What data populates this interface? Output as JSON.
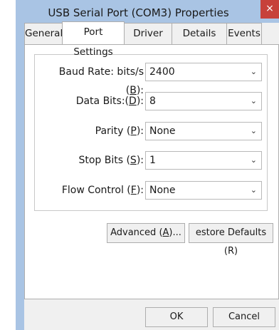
{
  "window": {
    "title": "USB Serial Port (COM3) Properties",
    "close_glyph": "×"
  },
  "tabs": [
    {
      "label": "General"
    },
    {
      "label": "Port Settings",
      "active": true
    },
    {
      "label": "Driver"
    },
    {
      "label": "Details"
    },
    {
      "label": "Events"
    }
  ],
  "settings": {
    "baud": {
      "label_pre": "Baud Rate: bits/s (",
      "key": "B",
      "label_post": "):",
      "value": "2400"
    },
    "databits": {
      "label_pre": "Data Bits:(",
      "key": "D",
      "label_post": "):",
      "value": "8"
    },
    "parity": {
      "label_pre": "Parity (",
      "key": "P",
      "label_post": "):",
      "value": "None"
    },
    "stopbits": {
      "label_pre": "Stop Bits (",
      "key": "S",
      "label_post": "):",
      "value": "1"
    },
    "flow": {
      "label_pre": "Flow Control (",
      "key": "F",
      "label_post": "):",
      "value": "None"
    }
  },
  "buttons": {
    "advanced_pre": "Advanced (",
    "advanced_key": "A",
    "advanced_post": ")...",
    "restore": "estore Defaults (R)",
    "ok": "OK",
    "cancel": "Cancel"
  }
}
